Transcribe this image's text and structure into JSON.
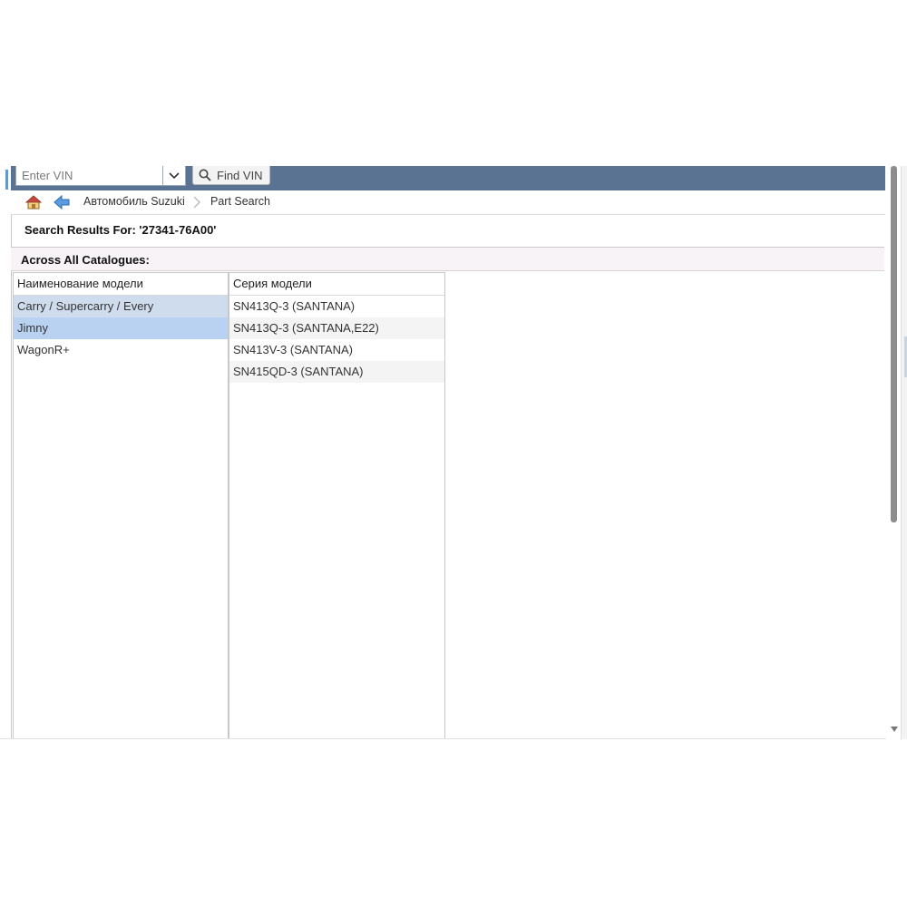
{
  "vin_search": {
    "placeholder": "Enter VIN",
    "value": "",
    "button_label": "Find VIN"
  },
  "breadcrumb": {
    "items": [
      "Автомобиль Suzuki",
      "Part Search"
    ]
  },
  "results": {
    "title": "Search Results For: '27341-76A00'",
    "section_title": "Across All Catalogues:"
  },
  "models_column": {
    "header": "Наименование модели",
    "items": [
      "Carry / Supercarry / Every",
      "Jimny",
      "WagonR+"
    ]
  },
  "series_column": {
    "header": "Серия модели",
    "items": [
      "SN413Q-3 (SANTANA)",
      "SN413Q-3 (SANTANA,E22)",
      "SN413V-3 (SANTANA)",
      "SN415QD-3 (SANTANA)"
    ]
  },
  "colors": {
    "topbar": "#5a7392",
    "selected_row": "#b9d2f2",
    "hover_row": "#cfdcee"
  },
  "icons": [
    "chevron-down-icon",
    "search-icon",
    "home-icon",
    "back-arrow-icon",
    "chevron-right-icon"
  ]
}
